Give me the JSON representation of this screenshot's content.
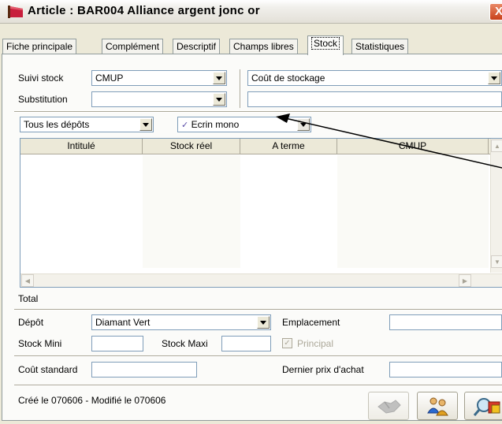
{
  "window": {
    "title": "Article : BAR004 Alliance argent jonc or",
    "close_symbol": "X"
  },
  "tabs": [
    {
      "label": "Fiche principale"
    },
    {
      "label": "Complément"
    },
    {
      "label": "Descriptif"
    },
    {
      "label": "Champs libres"
    },
    {
      "label": "Stock",
      "active": true
    },
    {
      "label": "Statistiques"
    }
  ],
  "stock_settings": {
    "suivi_stock_label": "Suivi stock",
    "suivi_stock_value": "CMUP",
    "substitution_label": "Substitution",
    "substitution_value": "",
    "cout_stockage_value": "Coût de stockage",
    "cout_stockage_field": ""
  },
  "filters": {
    "depots_value": "Tous les dépôts",
    "gamme_value": "Ecrin mono",
    "gamme_icon": "checkmark-icon"
  },
  "grid": {
    "columns": [
      "Intitulé",
      "Stock réel",
      "A terme",
      "CMUP"
    ],
    "rows": []
  },
  "total_label": "Total",
  "depot": {
    "depot_label": "Dépôt",
    "depot_value": "Diamant Vert",
    "emplacement_label": "Emplacement",
    "emplacement_value": "",
    "stock_mini_label": "Stock Mini",
    "stock_mini_value": "",
    "stock_maxi_label": "Stock Maxi",
    "stock_maxi_value": "",
    "principal_label": "Principal",
    "principal_checked": true
  },
  "prices": {
    "cout_standard_label": "Coût standard",
    "cout_standard_value": "",
    "dernier_prix_label": "Dernier prix d'achat",
    "dernier_prix_value": ""
  },
  "footer": {
    "created_text": "Créé le 070606 - Modifié le 070606"
  },
  "colors": {
    "title_icon": "#c81e3c",
    "close_button": "#d8542a",
    "panel_bg": "#fbfbf9",
    "arrow": "#000000"
  }
}
